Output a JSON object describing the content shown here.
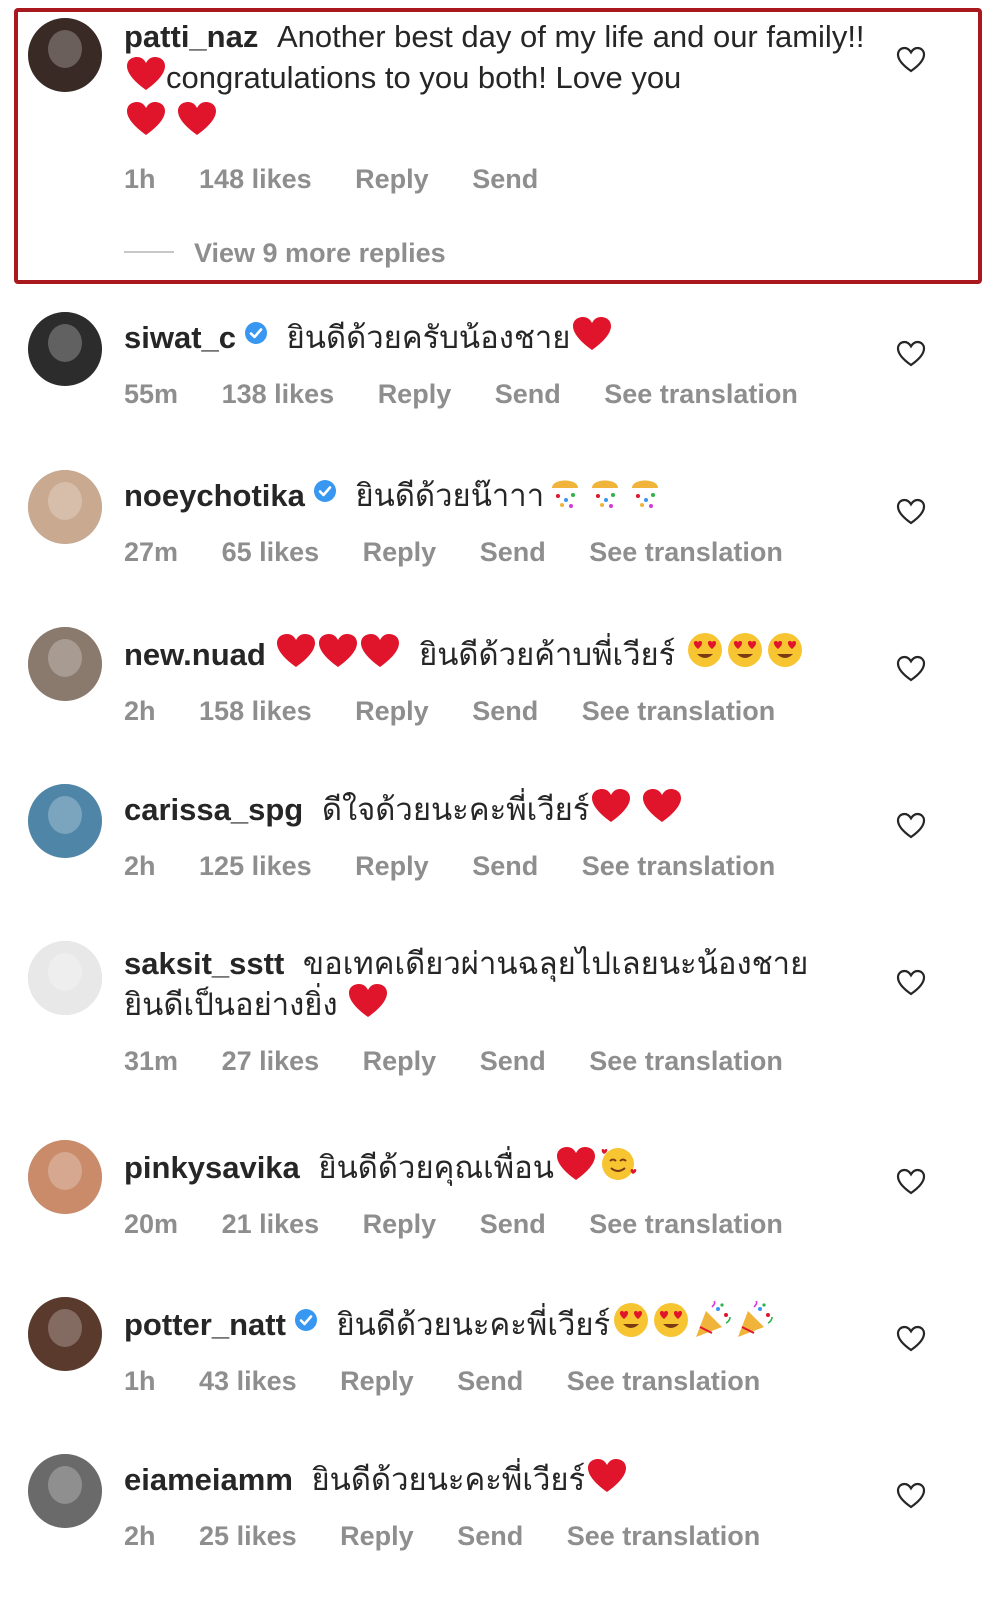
{
  "labels": {
    "reply": "Reply",
    "send": "Send",
    "see_translation": "See translation",
    "view_replies": "View 9 more replies"
  },
  "comments": [
    {
      "username": "patti_naz",
      "verified": false,
      "text": "Another best day of my life and our family!!",
      "text2": "congratulations to you both! Love you",
      "time": "1h",
      "likes": "148 likes",
      "translation": false,
      "avatar_color": "#3a2a25"
    },
    {
      "username": "siwat_c",
      "verified": true,
      "text": "ยินดีด้วยครับน้องชาย",
      "time": "55m",
      "likes": "138 likes",
      "translation": true,
      "avatar_color": "#2c2c2c"
    },
    {
      "username": "noeychotika",
      "verified": true,
      "text": "ยินดีด้วยน๊าาา",
      "time": "27m",
      "likes": "65 likes",
      "translation": true,
      "avatar_color": "#c9a98f"
    },
    {
      "username": "new.nuad",
      "verified": false,
      "text": "ยินดีด้วยค้าบพี่เวียร์",
      "time": "2h",
      "likes": "158 likes",
      "translation": true,
      "avatar_color": "#8a7a6e"
    },
    {
      "username": "carissa_spg",
      "verified": false,
      "text": "ดีใจด้วยนะคะพี่เวียร์",
      "time": "2h",
      "likes": "125 likes",
      "translation": true,
      "avatar_color": "#4f86a8"
    },
    {
      "username": "saksit_sstt",
      "verified": false,
      "text": "ขอเทคเดียวผ่านฉลุยไปเลยนะน้องชาย",
      "text2": "ยินดีเป็นอย่างยิ่ง",
      "time": "31m",
      "likes": "27 likes",
      "translation": true,
      "avatar_color": "#e8e8e8"
    },
    {
      "username": "pinkysavika",
      "verified": false,
      "text": "ยินดีด้วยคุณเพื่อน",
      "time": "20m",
      "likes": "21 likes",
      "translation": true,
      "avatar_color": "#c98b6a"
    },
    {
      "username": "potter_natt",
      "verified": true,
      "text": "ยินดีด้วยนะคะพี่เวียร์",
      "time": "1h",
      "likes": "43 likes",
      "translation": true,
      "avatar_color": "#5b3a2e"
    },
    {
      "username": "eiameiamm",
      "verified": false,
      "text": "ยินดีด้วยนะคะพี่เวียร์",
      "time": "2h",
      "likes": "25 likes",
      "translation": true,
      "avatar_color": "#6a6a6a"
    }
  ],
  "colors": {
    "highlight": "#a8181c",
    "verified": "#3897f0",
    "heart": "#e0152b",
    "muted": "#8e8e8e"
  },
  "icons": {
    "like": "heart-outline-icon",
    "emoji_heart": "red-heart-emoji",
    "emoji_love": "heart-eyes-emoji",
    "emoji_party": "party-popper-emoji",
    "emoji_confetti": "confetti-ball-emoji",
    "emoji_smile_hearts": "smiling-face-with-hearts-emoji"
  }
}
